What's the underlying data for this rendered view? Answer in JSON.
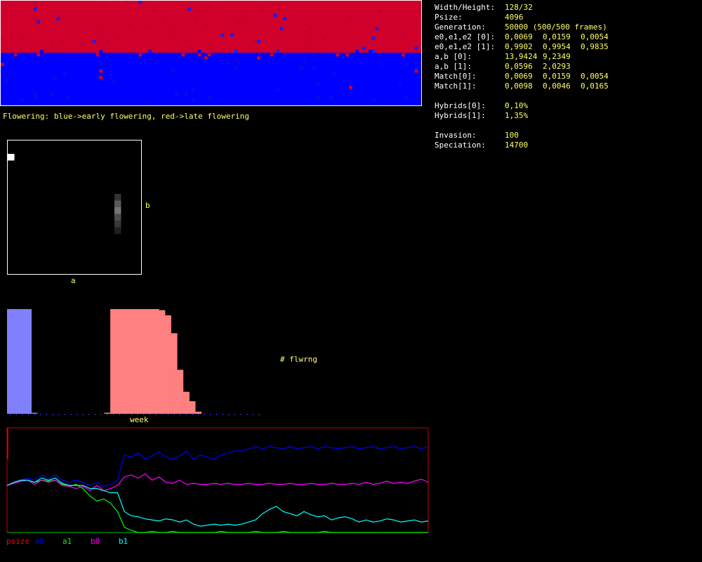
{
  "population_map": {
    "caption": "Flowering: blue->early flowering, red->late flowering",
    "colors": {
      "early": "#0000ff",
      "late": "#d0002a"
    }
  },
  "stats": [
    {
      "label": "Width/Height:",
      "values": [
        "128/32"
      ]
    },
    {
      "label": "Psize:",
      "values": [
        "4096"
      ]
    },
    {
      "label": "Generation:",
      "values": [
        "50000 (500/500 frames)"
      ]
    },
    {
      "label": "e0,e1,e2 [0]:",
      "values": [
        "0,0069",
        "0,0159",
        "0,0054"
      ]
    },
    {
      "label": "e0,e1,e2 [1]:",
      "values": [
        "0,9902",
        "0,9954",
        "0,9835"
      ]
    },
    {
      "label": "a,b [0]:",
      "values": [
        "13,9424",
        "9,2349"
      ]
    },
    {
      "label": "a,b [1]:",
      "values": [
        "0,0596",
        "2,0293"
      ]
    },
    {
      "label": "Match[0]:",
      "values": [
        "0,0069",
        "0,0159",
        "0,0054"
      ]
    },
    {
      "label": "Match[1]:",
      "values": [
        "0,0098",
        "0,0046",
        "0,0165"
      ]
    },
    {
      "label": "",
      "values": []
    },
    {
      "label": "Hybrids[0]:",
      "values": [
        "0,10%"
      ]
    },
    {
      "label": "Hybrids[1]:",
      "values": [
        "1,35%"
      ]
    },
    {
      "label": "",
      "values": []
    },
    {
      "label": "Invasion:",
      "values": [
        "100"
      ]
    },
    {
      "label": "Speciation:",
      "values": [
        "14700"
      ]
    }
  ],
  "chart_data": [
    {
      "type": "heatmap",
      "xlabel": "a",
      "ylabel": "b",
      "cells": [
        {
          "col": 0,
          "row": 2,
          "intensity": 1.0
        },
        {
          "col": 16,
          "row": 8,
          "intensity": 0.2
        },
        {
          "col": 16,
          "row": 9,
          "intensity": 0.35
        },
        {
          "col": 16,
          "row": 10,
          "intensity": 0.45
        },
        {
          "col": 16,
          "row": 11,
          "intensity": 0.3
        },
        {
          "col": 16,
          "row": 12,
          "intensity": 0.22
        },
        {
          "col": 16,
          "row": 13,
          "intensity": 0.12
        }
      ],
      "grid": [
        20,
        20
      ]
    },
    {
      "type": "bar",
      "xlabel": "week",
      "ylabel": "# flwrng",
      "weeks": 42,
      "series": [
        {
          "color": "#8080ff",
          "values": [
            1,
            1,
            1,
            1,
            0.01,
            0,
            0,
            0,
            0,
            0,
            0,
            0,
            0,
            0,
            0,
            0,
            0,
            0,
            0,
            0,
            0,
            0,
            0,
            0,
            0,
            0,
            0,
            0,
            0,
            0,
            0,
            0,
            0,
            0,
            0,
            0,
            0,
            0,
            0,
            0,
            0,
            0
          ]
        },
        {
          "color": "#ff8080",
          "values": [
            0,
            0,
            0,
            0,
            0,
            0,
            0,
            0,
            0,
            0,
            0,
            0,
            0,
            0,
            0,
            0,
            0.01,
            1,
            1,
            1,
            1,
            1,
            1,
            1,
            1,
            0.99,
            0.94,
            0.77,
            0.42,
            0.21,
            0.12,
            0.02,
            0,
            0,
            0,
            0,
            0,
            0,
            0,
            0,
            0,
            0
          ]
        }
      ]
    },
    {
      "type": "line",
      "ylim": [
        0,
        1
      ],
      "series": [
        {
          "name": "psize",
          "color": "#ff0000",
          "values": [
            1.0,
            0.7
          ]
        },
        {
          "name": "a0",
          "color": "#0000ff",
          "values": [
            0.45,
            0.48,
            0.5,
            0.52,
            0.5,
            0.55,
            0.52,
            0.55,
            0.5,
            0.48,
            0.5,
            0.48,
            0.45,
            0.48,
            0.44,
            0.46,
            0.5,
            0.74,
            0.72,
            0.76,
            0.7,
            0.73,
            0.77,
            0.72,
            0.7,
            0.73,
            0.78,
            0.7,
            0.74,
            0.72,
            0.7,
            0.74,
            0.76,
            0.78,
            0.78,
            0.8,
            0.82,
            0.8,
            0.82,
            0.81,
            0.8,
            0.82,
            0.8,
            0.81,
            0.82,
            0.8,
            0.82,
            0.81,
            0.8,
            0.81,
            0.82,
            0.8,
            0.81,
            0.82,
            0.8,
            0.81,
            0.82,
            0.8,
            0.81,
            0.82,
            0.8,
            0.82
          ]
        },
        {
          "name": "a1",
          "color": "#00ff00",
          "values": [
            0.45,
            0.47,
            0.49,
            0.5,
            0.48,
            0.5,
            0.49,
            0.5,
            0.46,
            0.44,
            0.46,
            0.42,
            0.35,
            0.3,
            0.32,
            0.28,
            0.2,
            0.05,
            0.02,
            0.0,
            0.0,
            0.01,
            0.0,
            0.0,
            0.01,
            0.0,
            0.0,
            0.0,
            0.0,
            0.0,
            0.0,
            0.01,
            0.0,
            0.0,
            0.0,
            0.0,
            0.01,
            0.0,
            0.0,
            0.0,
            0.01,
            0.0,
            0.0,
            0.0,
            0.0,
            0.0,
            0.01,
            0.0,
            0.0,
            0.0,
            0.0,
            0.0,
            0.0,
            0.0,
            0.0,
            0.0,
            0.0,
            0.0,
            0.0,
            0.0,
            0.0,
            0.0
          ]
        },
        {
          "name": "b0",
          "color": "#ff00ff",
          "values": [
            0.45,
            0.47,
            0.49,
            0.5,
            0.46,
            0.5,
            0.48,
            0.5,
            0.45,
            0.44,
            0.42,
            0.44,
            0.4,
            0.45,
            0.4,
            0.42,
            0.45,
            0.53,
            0.55,
            0.52,
            0.56,
            0.5,
            0.53,
            0.48,
            0.47,
            0.5,
            0.46,
            0.47,
            0.46,
            0.46,
            0.47,
            0.46,
            0.47,
            0.46,
            0.46,
            0.47,
            0.46,
            0.46,
            0.47,
            0.46,
            0.46,
            0.47,
            0.46,
            0.46,
            0.47,
            0.46,
            0.46,
            0.47,
            0.46,
            0.46,
            0.47,
            0.46,
            0.48,
            0.46,
            0.47,
            0.49,
            0.47,
            0.48,
            0.47,
            0.49,
            0.51,
            0.48
          ]
        },
        {
          "name": "b1",
          "color": "#00ffff",
          "values": [
            0.45,
            0.48,
            0.5,
            0.5,
            0.48,
            0.52,
            0.5,
            0.52,
            0.47,
            0.45,
            0.45,
            0.45,
            0.42,
            0.42,
            0.4,
            0.38,
            0.38,
            0.2,
            0.16,
            0.15,
            0.13,
            0.12,
            0.11,
            0.13,
            0.12,
            0.1,
            0.12,
            0.08,
            0.06,
            0.07,
            0.08,
            0.07,
            0.08,
            0.07,
            0.08,
            0.1,
            0.12,
            0.18,
            0.22,
            0.25,
            0.2,
            0.18,
            0.16,
            0.2,
            0.17,
            0.15,
            0.16,
            0.12,
            0.14,
            0.15,
            0.13,
            0.1,
            0.12,
            0.1,
            0.11,
            0.13,
            0.12,
            0.1,
            0.11,
            0.12,
            0.1,
            0.11
          ]
        }
      ]
    }
  ]
}
